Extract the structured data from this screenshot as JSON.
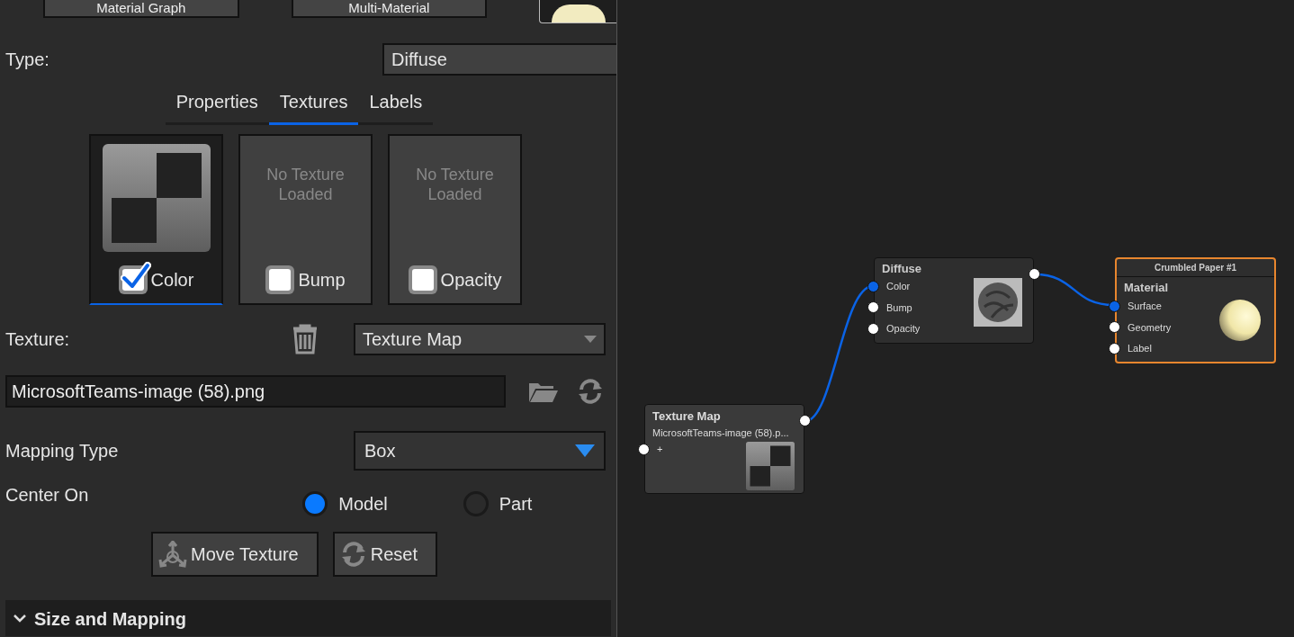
{
  "toolbar": {
    "buttons": [
      {
        "label": "Material Graph"
      },
      {
        "label": "Multi-Material"
      }
    ]
  },
  "type": {
    "label": "Type:",
    "value": "Diffuse"
  },
  "tabs": [
    {
      "label": "Properties",
      "selected": false
    },
    {
      "label": "Textures",
      "selected": true
    },
    {
      "label": "Labels",
      "selected": false
    }
  ],
  "texture_slots": [
    {
      "label": "Color",
      "checked": true,
      "selected": true,
      "loaded": true
    },
    {
      "label": "Bump",
      "checked": false,
      "selected": false,
      "loaded": false,
      "empty_text": "No Texture Loaded"
    },
    {
      "label": "Opacity",
      "checked": false,
      "selected": false,
      "loaded": false,
      "empty_text": "No Texture Loaded"
    }
  ],
  "texture": {
    "label": "Texture:",
    "value": "Texture Map",
    "file": "MicrosoftTeams-image (58).png"
  },
  "mapping_type": {
    "label": "Mapping Type",
    "value": "Box"
  },
  "center_on": {
    "label": "Center On",
    "options": [
      {
        "label": "Model",
        "selected": true
      },
      {
        "label": "Part",
        "selected": false
      }
    ]
  },
  "buttons": [
    {
      "kind": "move",
      "label": "Move Texture"
    },
    {
      "kind": "reset",
      "label": "Reset"
    }
  ],
  "section": {
    "label": "Size and Mapping",
    "expanded": true
  },
  "graph": {
    "nodes": [
      {
        "kind": "texture",
        "title": "Texture Map",
        "subtitle": "MicrosoftTeams-image (58).p...",
        "selected": false,
        "output_connected": true,
        "ports": [
          {
            "label": "+",
            "connected": false
          }
        ]
      },
      {
        "kind": "shader",
        "title": "Diffuse",
        "selected": false,
        "output_connected": true,
        "ports": [
          {
            "label": "Color",
            "connected": true
          },
          {
            "label": "Bump",
            "connected": false
          },
          {
            "label": "Opacity",
            "connected": false
          }
        ]
      },
      {
        "kind": "material",
        "header": "Crumbled Paper #1",
        "title": "Material",
        "selected": true,
        "ports": [
          {
            "label": "Surface",
            "connected": true
          },
          {
            "label": "Geometry",
            "connected": false
          },
          {
            "label": "Label",
            "connected": false
          }
        ]
      }
    ]
  }
}
